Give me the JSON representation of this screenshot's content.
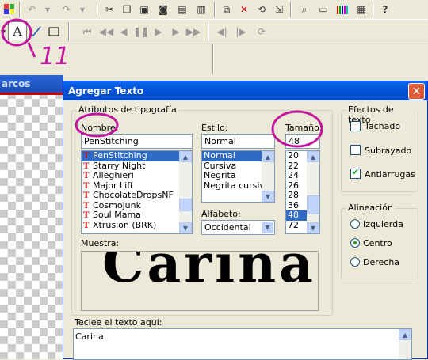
{
  "left_panel": {
    "title": "arcos"
  },
  "dialog": {
    "title": "Agregar Texto",
    "close_glyph": "✕",
    "typography": {
      "group_label": "Atributos de tipografía",
      "name_label": "Nombre:",
      "name_value": "PenStitching",
      "fonts": [
        "PenStitching",
        "Starry Night",
        "Alleghieri",
        "Major Lift",
        "ChocolateDropsNF",
        "Cosmojunk",
        "Soul Mama",
        "Xtrusion (BRK)"
      ],
      "style_label": "Estilo:",
      "style_value": "Normal",
      "styles": [
        "Normal",
        "Cursiva",
        "Negrita",
        "Negrita cursiva"
      ],
      "size_label": "Tamaño:",
      "size_value": "48",
      "sizes": [
        "20",
        "22",
        "24",
        "26",
        "28",
        "36",
        "48",
        "72"
      ],
      "alphabet_label": "Alfabeto:",
      "alphabet_value": "Occidental",
      "sample_label": "Muestra:",
      "sample_text": "Carina"
    },
    "effects": {
      "group_label": "Efectos de texto",
      "strikeout": "Tachado",
      "underline": "Subrayado",
      "antialias": "Antiarrugas",
      "antialias_checked": true
    },
    "alignment": {
      "group_label": "Alineación",
      "left": "Izquierda",
      "center": "Centro",
      "right": "Derecha",
      "selected": "center"
    },
    "text_entry": {
      "label": "Teclee el texto aquí:",
      "value": "Carina"
    }
  },
  "toolbar": {
    "text_tool_glyph": "A"
  },
  "annotation": {
    "text": "11",
    "color": "#c0179f"
  }
}
